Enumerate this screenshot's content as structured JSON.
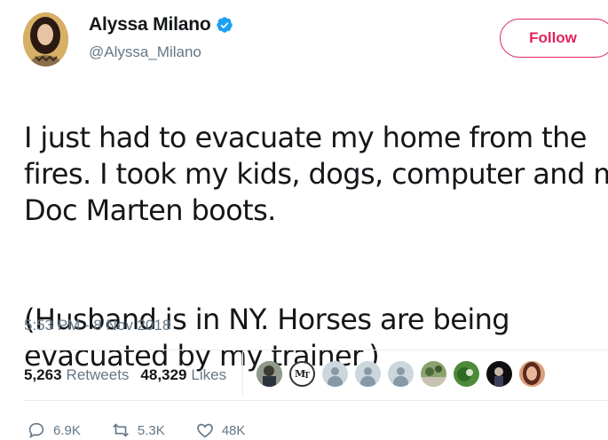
{
  "author": {
    "display_name": "Alyssa Milano",
    "handle": "@Alyssa_Milano",
    "verified": true
  },
  "follow_button": {
    "label": "Follow"
  },
  "tweet": {
    "paragraph1": "I just had to evacuate my home from the\nfires. I took my kids, dogs, computer and my\nDoc Marten boots.",
    "paragraph2": "(Husband is in NY. Horses are being\nevacuated by my trainer.)"
  },
  "timestamp": "5:53 PM - 8 Nov 2018",
  "stats": {
    "retweets_count": "5,263",
    "retweets_label": "Retweets",
    "likes_count": "48,329",
    "likes_label": "Likes"
  },
  "actions": {
    "replies": "6.9K",
    "retweets": "5.3K",
    "likes": "48K"
  },
  "colors": {
    "accent_follow": "#e0245e",
    "verified_blue": "#1da1f2",
    "secondary_text": "#657786"
  },
  "liker_avatars": [
    "photo",
    "mt-logo",
    "default",
    "default",
    "default",
    "photo",
    "photo",
    "photo",
    "photo"
  ]
}
